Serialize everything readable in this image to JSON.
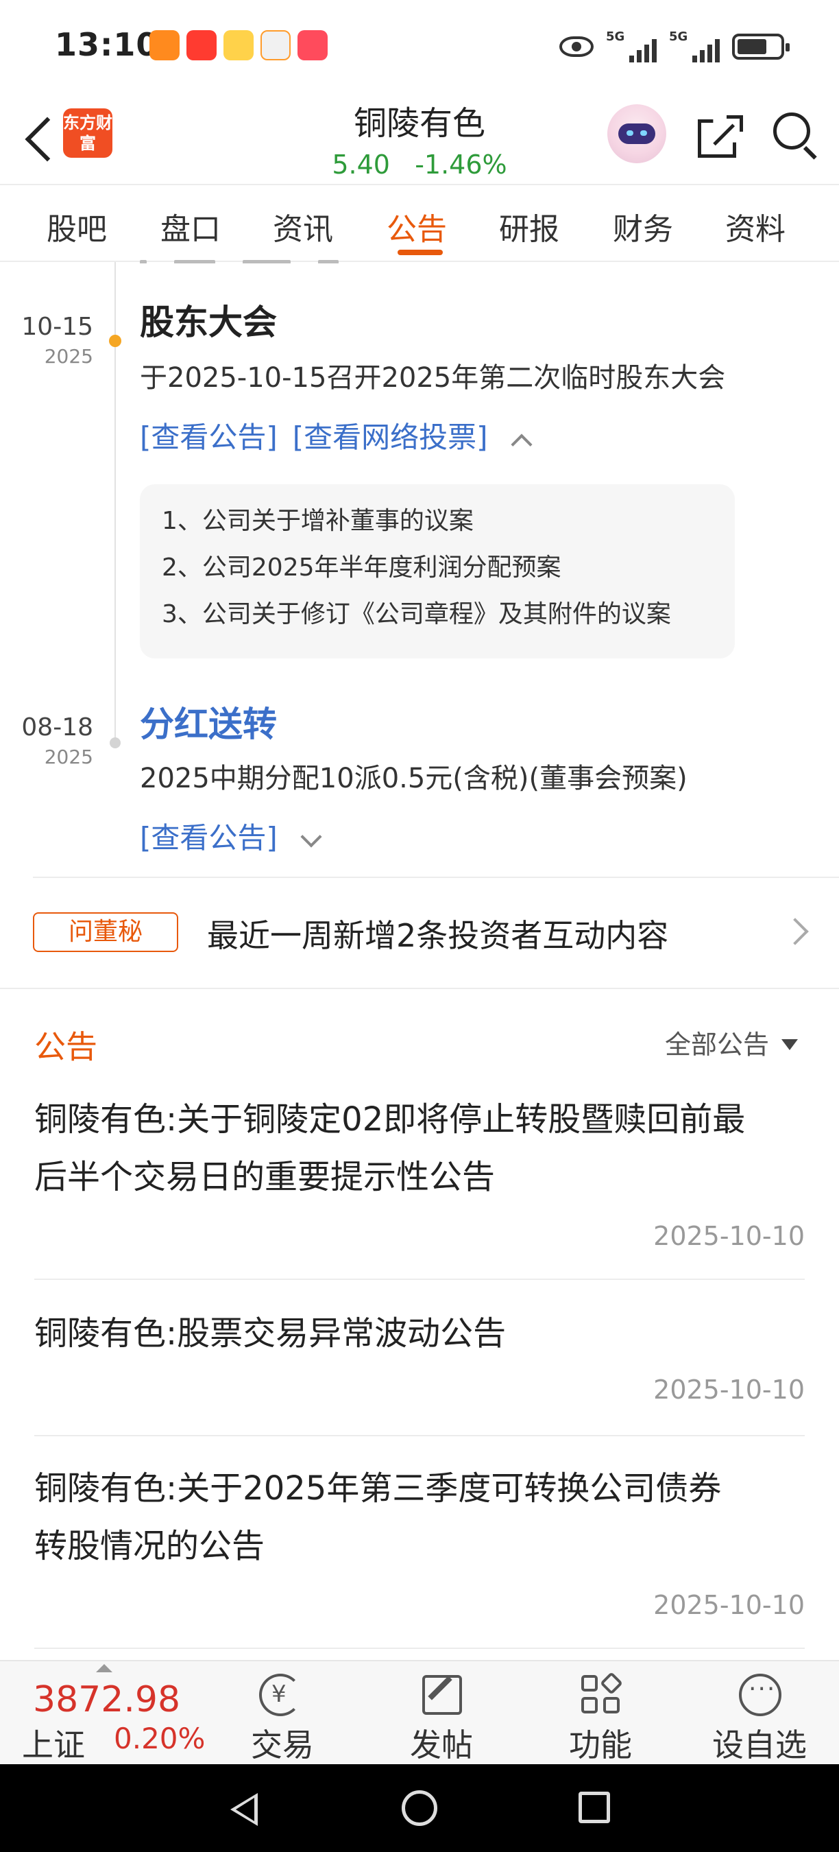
{
  "status_bar": {
    "time": "13:10",
    "signal_labels": [
      "5G",
      "5G"
    ]
  },
  "header": {
    "logo_text": "东方财富",
    "stock_name": "铜陵有色",
    "price": "5.40",
    "change": "-1.46%"
  },
  "tabs": [
    "股吧",
    "盘口",
    "资讯",
    "公告",
    "研报",
    "财务",
    "资料"
  ],
  "active_tab": "公告",
  "timeline": {
    "events": [
      {
        "month_day": "10-15",
        "year": "2025",
        "title": "股东大会",
        "description": "于2025-10-15召开2025年第二次临时股东大会",
        "links": [
          "[查看公告]",
          "[查看网络投票]"
        ],
        "agenda": [
          "1、公司关于增补董事的议案",
          "2、公司2025年半年度利润分配预案",
          "3、公司关于修订《公司章程》及其附件的议案"
        ]
      },
      {
        "month_day": "08-18",
        "year": "2025",
        "title": "分红送转",
        "description": "2025中期分配10派0.5元(含税)(董事会预案)",
        "links": [
          "[查看公告]"
        ]
      }
    ]
  },
  "ask_secretary": {
    "badge": "问董秘",
    "text": "最近一周新增2条投资者互动内容"
  },
  "announcements": {
    "section_title": "公告",
    "filter_label": "全部公告",
    "items": [
      {
        "title_line1": "铜陵有色:关于铜陵定02即将停止转股暨赎回前最",
        "title_line2": "后半个交易日的重要提示性公告",
        "date": "2025-10-10"
      },
      {
        "title_line1": "铜陵有色:股票交易异常波动公告",
        "title_line2": "",
        "date": "2025-10-10"
      },
      {
        "title_line1": "铜陵有色:关于2025年第三季度可转换公司债券",
        "title_line2": "转股情况的公告",
        "date": "2025-10-10"
      }
    ]
  },
  "toolbar": {
    "index_value": "3872.98",
    "index_name": "上证",
    "index_change": "0.20%",
    "items": [
      "交易",
      "发帖",
      "功能",
      "设自选"
    ]
  },
  "colors": {
    "accent": "#e8590c",
    "link_blue": "#3b6fc9",
    "down_green": "#2e9b3a",
    "up_red": "#d6332a"
  }
}
